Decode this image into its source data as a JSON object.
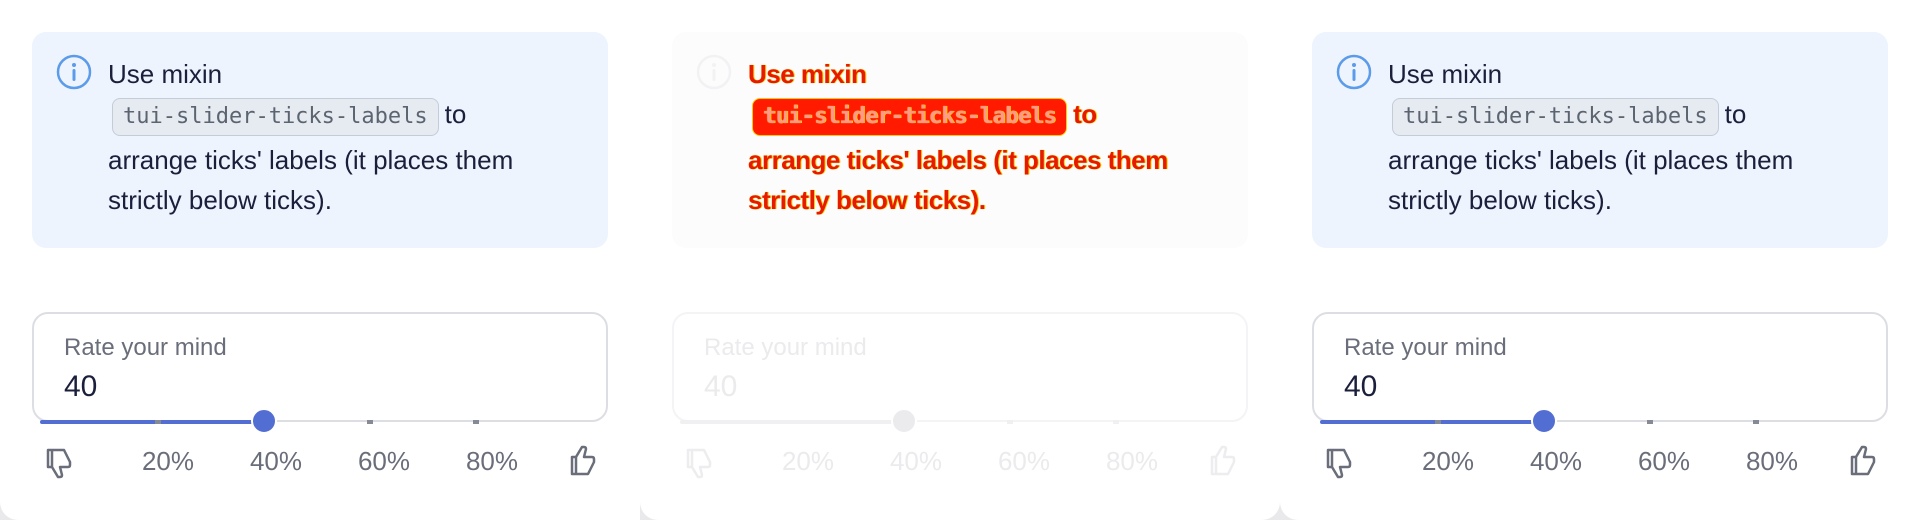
{
  "notice": {
    "prefix": "Use mixin",
    "code": "tui-slider-ticks-labels",
    "suffix": "to",
    "line3": "arrange ticks' labels (it places them",
    "line4": "strictly below ticks)."
  },
  "field": {
    "label": "Rate your mind",
    "value": "40"
  },
  "slider": {
    "value_percent": 40,
    "ticks_percent": [
      20,
      40,
      60,
      80
    ]
  },
  "tick_labels": [
    "20%",
    "40%",
    "60%",
    "80%"
  ],
  "icons": {
    "info": "info-circle-icon",
    "left": "thumbs-down-icon",
    "right": "thumbs-up-icon"
  },
  "colors": {
    "accent": "#526ed3",
    "info": "#5b9bea",
    "notice_bg": "#edf4fd"
  }
}
